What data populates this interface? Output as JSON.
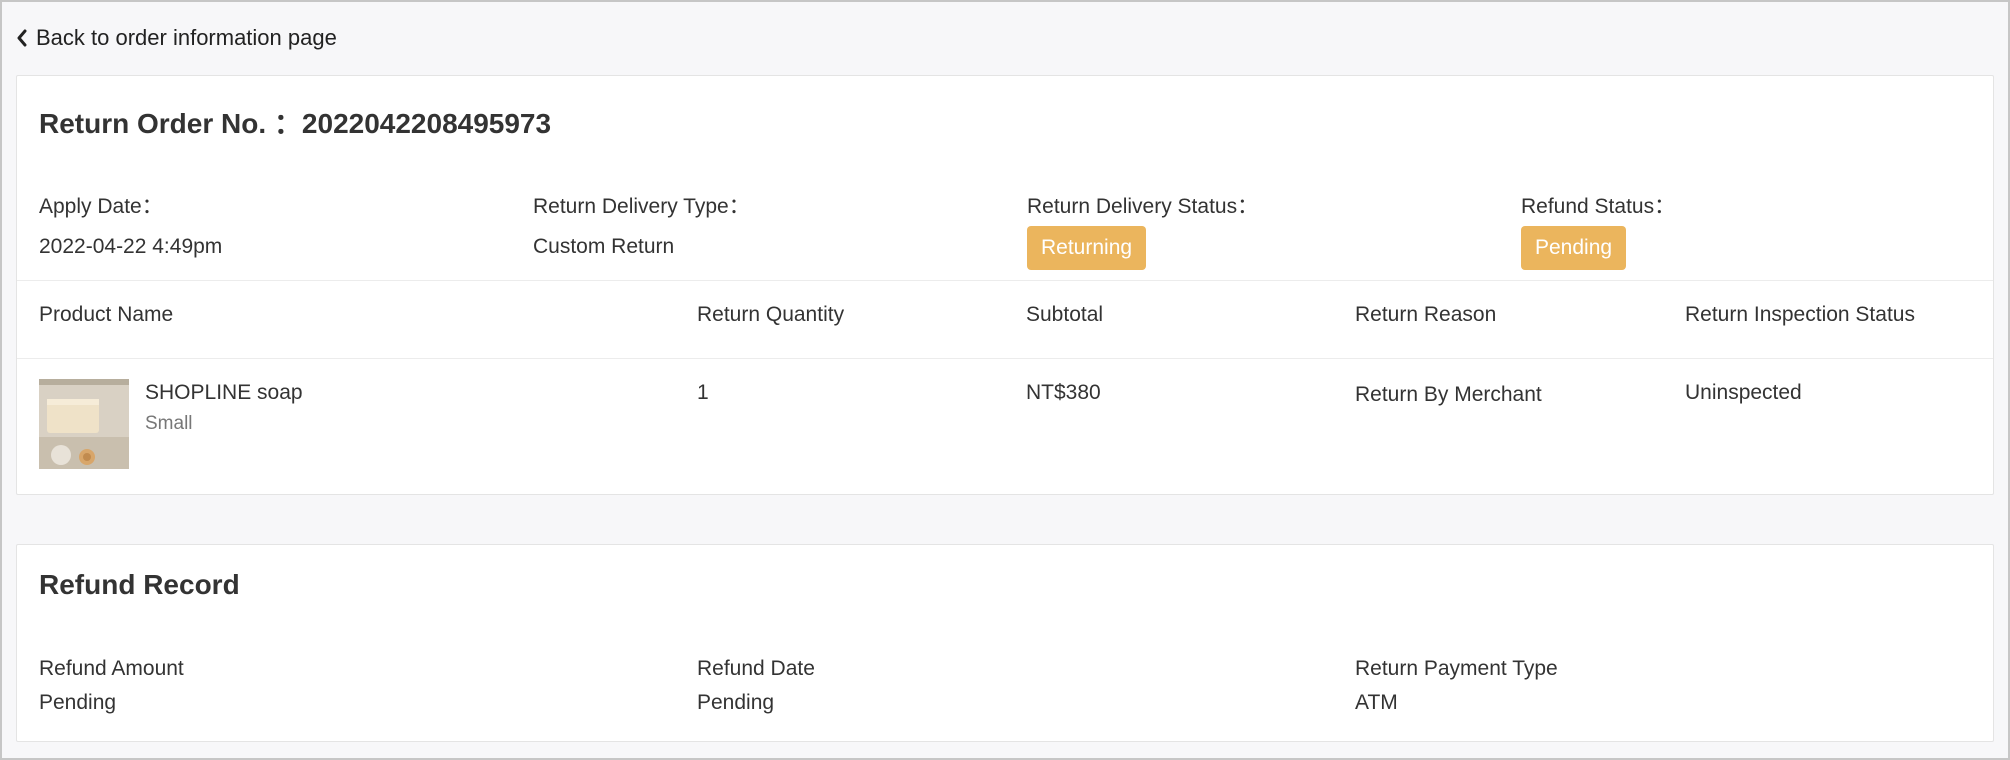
{
  "nav": {
    "back_label": "Back to order information page"
  },
  "order": {
    "title_label": "Return Order No. ：",
    "order_no": "2022042208495973",
    "apply_date_label": "Apply Date：",
    "apply_date_value": "2022-04-22 4:49pm",
    "delivery_type_label": "Return Delivery Type：",
    "delivery_type_value": "Custom Return",
    "delivery_status_label": "Return Delivery Status：",
    "delivery_status_value": "Returning",
    "refund_status_label": "Refund Status：",
    "refund_status_value": "Pending",
    "badge_color": "#ebb55d"
  },
  "table": {
    "headers": {
      "product_name": "Product Name",
      "return_quantity": "Return Quantity",
      "subtotal": "Subtotal",
      "return_reason": "Return Reason",
      "inspection_status": "Return Inspection Status"
    },
    "rows": [
      {
        "product_name": "SHOPLINE soap",
        "variant": "Small",
        "return_quantity": "1",
        "subtotal": "NT$380",
        "return_reason": "Return By Merchant",
        "inspection_status": "Uninspected"
      }
    ]
  },
  "refund": {
    "title": "Refund Record",
    "amount_label": "Refund Amount",
    "amount_value": "Pending",
    "date_label": "Refund Date",
    "date_value": "Pending",
    "payment_type_label": "Return Payment Type",
    "payment_type_value": "ATM"
  }
}
